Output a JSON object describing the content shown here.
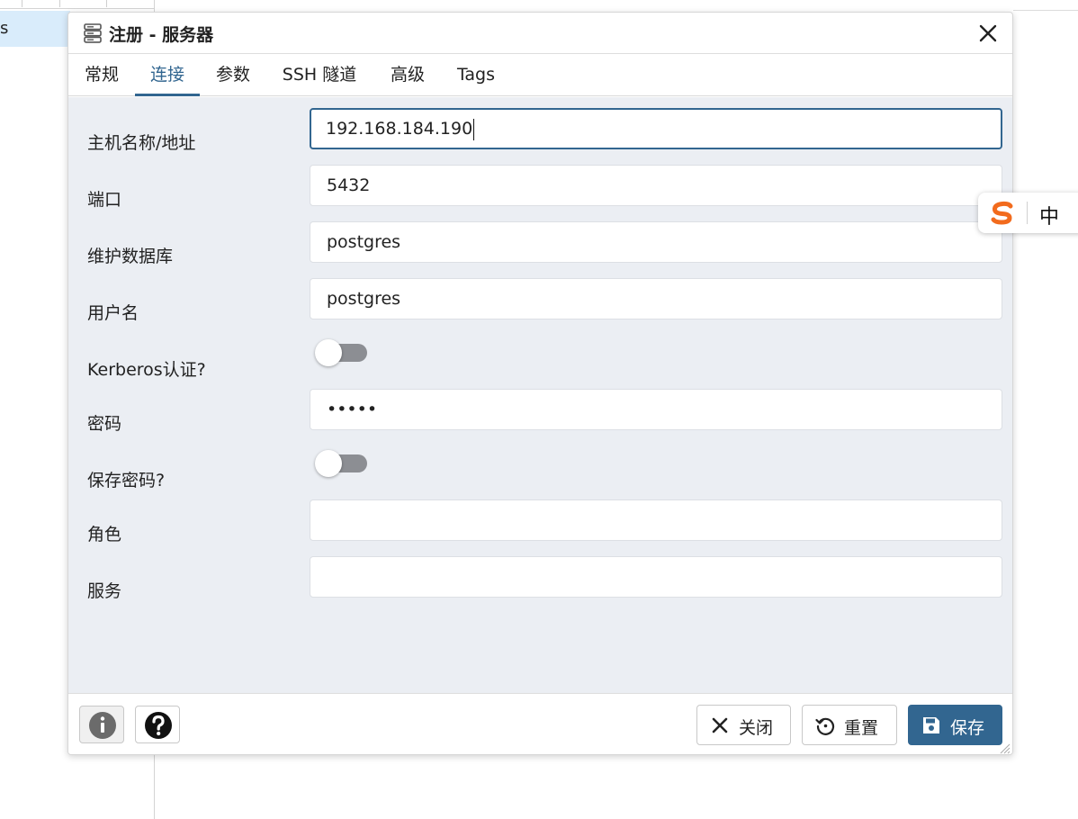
{
  "background": {
    "tree_item_label": "s"
  },
  "dialog": {
    "title": "注册 - 服务器",
    "title_icon": "server-icon",
    "close_icon": "close-icon"
  },
  "tabs": [
    {
      "label": "常规",
      "active": false
    },
    {
      "label": "连接",
      "active": true
    },
    {
      "label": "参数",
      "active": false
    },
    {
      "label": "SSH 隧道",
      "active": false
    },
    {
      "label": "高级",
      "active": false
    },
    {
      "label": "Tags",
      "active": false
    }
  ],
  "form": {
    "host": {
      "label": "主机名称/地址",
      "value": "192.168.184.190"
    },
    "port": {
      "label": "端口",
      "value": "5432"
    },
    "maintenance_db": {
      "label": "维护数据库",
      "value": "postgres"
    },
    "username": {
      "label": "用户名",
      "value": "postgres"
    },
    "kerberos": {
      "label": "Kerberos认证?",
      "enabled": false
    },
    "password": {
      "label": "密码",
      "value": "•••••"
    },
    "save_password": {
      "label": "保存密码?",
      "enabled": false
    },
    "role": {
      "label": "角色",
      "value": ""
    },
    "service": {
      "label": "服务",
      "value": ""
    }
  },
  "footer": {
    "info_icon": "info-icon",
    "help_icon": "help-icon",
    "close_label": "关闭",
    "reset_label": "重置",
    "save_label": "保存"
  },
  "ime": {
    "logo_icon": "sogou-s-icon",
    "mode_label": "中"
  },
  "colors": {
    "accent": "#326690",
    "form_background": "#ebeef3",
    "tree_selection": "#d9ecfb",
    "toggle_off": "#8c8e93",
    "ime_logo": "#f26b1d"
  }
}
